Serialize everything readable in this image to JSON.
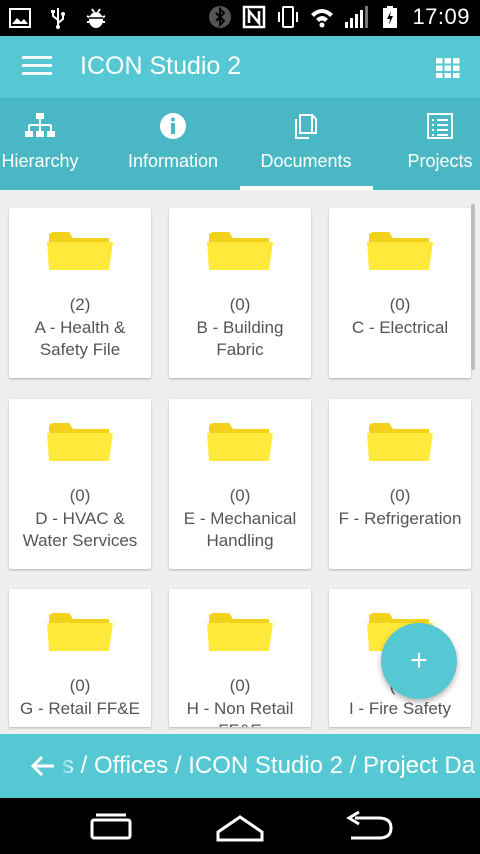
{
  "status_bar": {
    "time": "17:09",
    "left_icons": [
      "image-icon",
      "usb-icon",
      "android-debug-icon"
    ],
    "right_icons": [
      "bluetooth-icon",
      "nfc-icon",
      "vibrate-icon",
      "wifi-icon",
      "signal-icon",
      "battery-charging-icon"
    ]
  },
  "app_bar": {
    "title": "ICON Studio 2",
    "menu_icon": "menu-icon",
    "view_icon": "grid-view-icon"
  },
  "tabs": [
    {
      "label": "Hierarchy",
      "icon": "hierarchy-icon"
    },
    {
      "label": "Information",
      "icon": "info-icon"
    },
    {
      "label": "Documents",
      "icon": "documents-icon",
      "selected": true
    },
    {
      "label": "Projects",
      "icon": "list-icon"
    }
  ],
  "folders": [
    {
      "count": "(2)",
      "name": "A - Health & Safety File"
    },
    {
      "count": "(0)",
      "name": "B - Building Fabric"
    },
    {
      "count": "(0)",
      "name": "C - Electrical"
    },
    {
      "count": "(0)",
      "name": "D - HVAC & Water Services"
    },
    {
      "count": "(0)",
      "name": "E - Mechanical Handling"
    },
    {
      "count": "(0)",
      "name": "F - Refrigeration"
    },
    {
      "count": "(0)",
      "name": "G - Retail FF&E"
    },
    {
      "count": "(0)",
      "name": "H - Non Retail FF&E"
    },
    {
      "count": "(0)",
      "name": "I - Fire Safety"
    }
  ],
  "fab": {
    "label": "+"
  },
  "breadcrumb": {
    "text": "s / Offices / ICON Studio 2 / Project Da",
    "back_icon": "arrow-left-icon"
  },
  "nav_bar": {
    "icons": [
      "recent-apps-icon",
      "home-icon",
      "back-icon"
    ]
  },
  "colors": {
    "accent": "#55c8d3",
    "tab_bar": "#4ab8c4",
    "folder": "#ffe93b",
    "background": "#eeeeee"
  }
}
